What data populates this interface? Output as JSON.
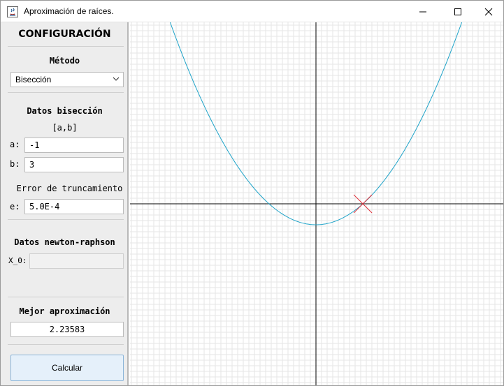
{
  "window": {
    "title": "Aproximación de raíces."
  },
  "sidebar": {
    "heading": "CONFIGURACIÓN",
    "method_label": "Método",
    "method_selected": "Bisección",
    "bisection": {
      "heading": "Datos bisección",
      "interval_label": "[a,b]",
      "a_label": "a:",
      "a_value": "-1",
      "b_label": "b:",
      "b_value": "3",
      "error_heading": "Error de truncamiento",
      "e_label": "e:",
      "e_value": "5.0E-4"
    },
    "newton": {
      "heading": "Datos newton-raphson",
      "x0_label": "X_0:",
      "x0_value": ""
    },
    "result": {
      "heading": "Mejor aproximación",
      "value": "2.23583"
    },
    "calculate_label": "Calcular"
  },
  "plot": {
    "curve_color": "#1ea3c8",
    "axis_color": "#000000",
    "grid_color": "#e6e6e6",
    "marker_color": "#e0303a",
    "function": "x^2 - 5",
    "root_marker_x": 2.23583
  }
}
